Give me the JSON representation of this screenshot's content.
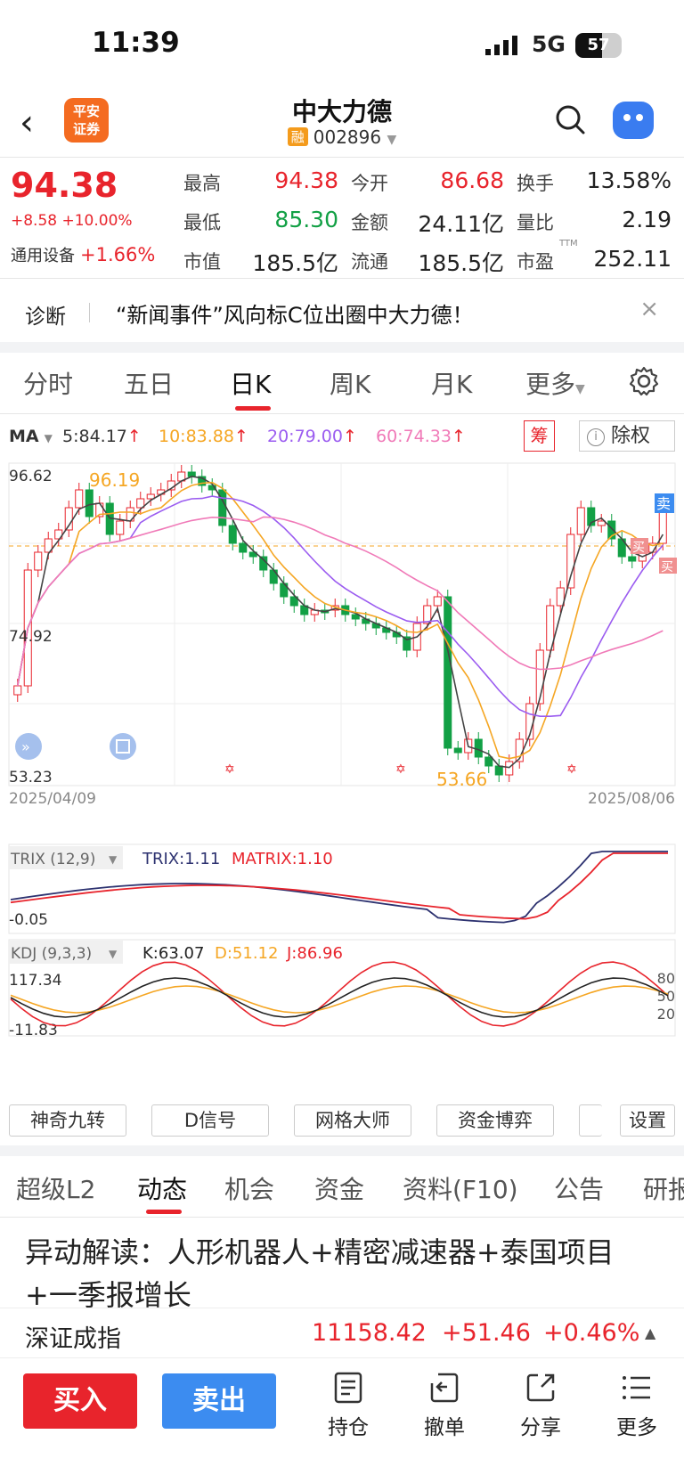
{
  "status": {
    "time": "11:39",
    "network": "5G",
    "battery": "57",
    "battery_level": 0.57
  },
  "header": {
    "title": "中大力德",
    "rong": "融",
    "code": "002896",
    "logo": "平安\n证券"
  },
  "quote": {
    "price": "94.38",
    "change": "+8.58 +10.00%",
    "sector_name": "通用设备",
    "sector_change": "+1.66%",
    "fields": [
      {
        "label": "最高",
        "value": "94.38"
      },
      {
        "label": "今开",
        "value": "86.68"
      },
      {
        "label": "换手",
        "value": "13.58%"
      },
      {
        "label": "最低",
        "value": "85.30"
      },
      {
        "label": "金额",
        "value": "24.11亿"
      },
      {
        "label": "量比",
        "value": "2.19"
      },
      {
        "label": "市值",
        "value": "185.5亿"
      },
      {
        "label": "流通",
        "value": "185.5亿"
      },
      {
        "label": "市盈",
        "value": "252.11"
      }
    ],
    "pe_sup": "TTM"
  },
  "diag": {
    "label": "诊断",
    "text": "“新闻事件”风向标C位出圈中大力德！",
    "close": "×"
  },
  "ktabs": [
    "分时",
    "五日",
    "日K",
    "周K",
    "月K",
    "更多"
  ],
  "ma": {
    "label": "MA",
    "ma5": "5:84.17",
    "ma10": "10:83.88",
    "ma20": "20:79.00",
    "ma60": "60:74.33",
    "up": "↑"
  },
  "chip_button": "筹",
  "adjust_button": "除权",
  "kchart": {
    "y_top": "96.62",
    "y_mid": "74.92",
    "y_bottom": "53.23",
    "high_mark": "96.19",
    "low_mark": "53.66",
    "date_start": "2025/04/09",
    "date_end": "2025/08/06",
    "sell_tag": "卖",
    "buy_tag": "买"
  },
  "trix": {
    "label": "TRIX (12,9)",
    "trix": "TRIX:1.11",
    "matrix": "MATRIX:1.10",
    "axis": "-0.05"
  },
  "kdj": {
    "label": "KDJ (9,3,3)",
    "k": "K:63.07",
    "d": "D:51.12",
    "j": "J:86.96",
    "y_top": "117.34",
    "y_bottom": "-11.83",
    "r80": "80",
    "r50": "50",
    "r20": "20"
  },
  "indicator_buttons": [
    "神奇九转",
    "D信号",
    "网格大师",
    "资金博弈",
    "设置"
  ],
  "news_tabs": [
    "超级L2",
    "动态",
    "机会",
    "资金",
    "资料(F10)",
    "公告",
    "研报"
  ],
  "news": {
    "headline": "异动解读：人形机器人+精密减速器+泰国项目+一季报增长"
  },
  "index": {
    "name": "深证成指",
    "value": "11158.42",
    "change": "+51.46",
    "pct": "+0.46%",
    "arrow": "▲"
  },
  "bottom": {
    "buy": "买入",
    "sell": "卖出",
    "actions": [
      "持仓",
      "撤单",
      "分享",
      "更多"
    ]
  },
  "colors": {
    "up": "#e8242c",
    "down": "#12a045",
    "ma5": "#444444",
    "ma10": "#f5a623",
    "ma20": "#9b5cf0",
    "ma60": "#f07ab8"
  }
}
